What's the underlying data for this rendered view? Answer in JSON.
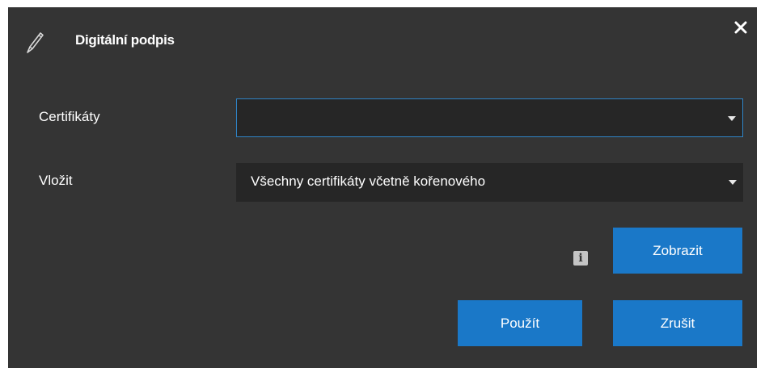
{
  "dialog": {
    "title": "Digitální podpis",
    "title_icon": "pencil-icon",
    "close_icon": "close-icon"
  },
  "fields": {
    "certificates": {
      "label": "Certifikáty",
      "value": "",
      "arrow_icon": "chevron-down-icon"
    },
    "insert": {
      "label": "Vložit",
      "value": "Všechny certifikáty včetně kořenového",
      "arrow_icon": "chevron-down-icon"
    }
  },
  "buttons": {
    "show_label": "Zobrazit",
    "apply_label": "Použít",
    "cancel_label": "Zrušit"
  },
  "info": {
    "glyph": "i",
    "icon": "info-icon"
  },
  "colors": {
    "dialog_bg": "#343434",
    "field_bg": "#262626",
    "accent": "#1a78c8",
    "focus_border": "#2f84c6",
    "text": "#ffffff"
  }
}
